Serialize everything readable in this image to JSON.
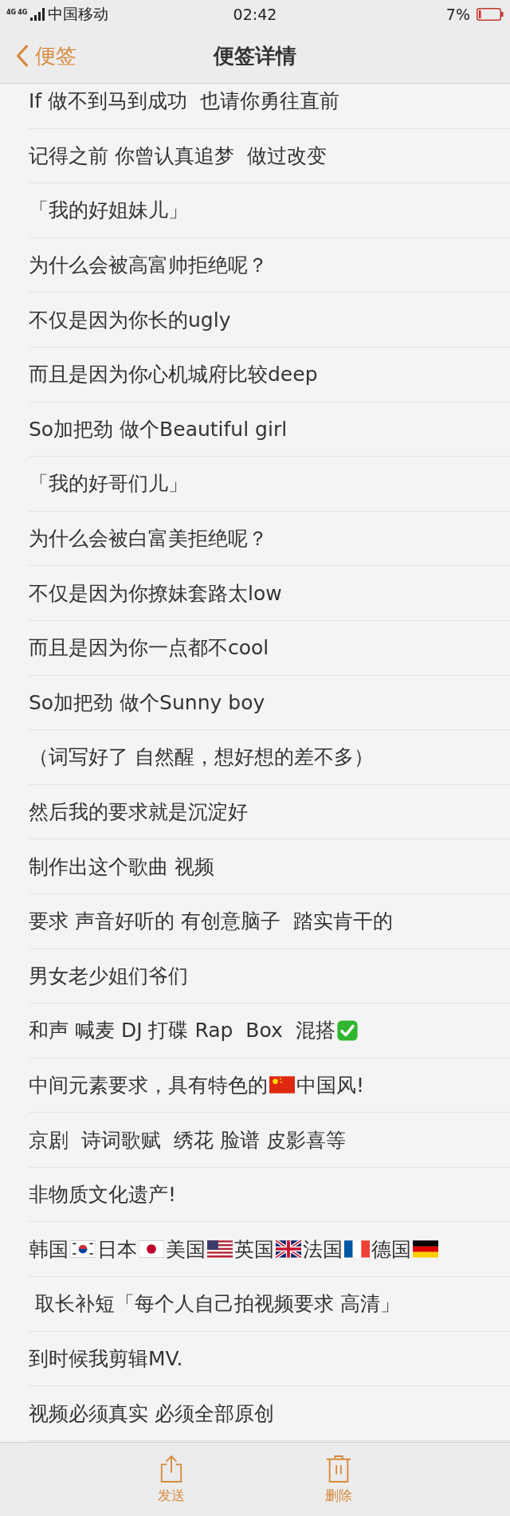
{
  "status_bar": {
    "network": "4G",
    "network_2": "4G",
    "carrier": "中国移动",
    "time": "02:42",
    "battery_percent": "7%"
  },
  "nav_bar": {
    "back_label": "便签",
    "title": "便签详情"
  },
  "lines": [
    {
      "segments": [
        {
          "kind": "text",
          "text": "If 做不到马到成功  也请你勇往直前"
        }
      ]
    },
    {
      "segments": [
        {
          "kind": "text",
          "text": "记得之前 你曾认真追梦  做过改变"
        }
      ]
    },
    {
      "segments": [
        {
          "kind": "text",
          "text": "「我的好姐妹儿」"
        }
      ]
    },
    {
      "segments": [
        {
          "kind": "text",
          "text": "为什么会被高富帅拒绝呢？"
        }
      ]
    },
    {
      "segments": [
        {
          "kind": "text",
          "text": "不仅是因为你长的ugly"
        }
      ]
    },
    {
      "segments": [
        {
          "kind": "text",
          "text": "而且是因为你心机城府比较deep"
        }
      ]
    },
    {
      "segments": [
        {
          "kind": "text",
          "text": "So加把劲 做个Beautiful girl"
        }
      ]
    },
    {
      "segments": [
        {
          "kind": "text",
          "text": "「我的好哥们儿」"
        }
      ]
    },
    {
      "segments": [
        {
          "kind": "text",
          "text": "为什么会被白富美拒绝呢？"
        }
      ]
    },
    {
      "segments": [
        {
          "kind": "text",
          "text": "不仅是因为你撩妹套路太low"
        }
      ]
    },
    {
      "segments": [
        {
          "kind": "text",
          "text": "而且是因为你一点都不cool"
        }
      ]
    },
    {
      "segments": [
        {
          "kind": "text",
          "text": "So加把劲 做个Sunny boy"
        }
      ]
    },
    {
      "segments": [
        {
          "kind": "text",
          "text": "（词写好了 自然醒，想好想的差不多）"
        }
      ]
    },
    {
      "segments": [
        {
          "kind": "text",
          "text": "然后我的要求就是沉淀好"
        }
      ]
    },
    {
      "segments": [
        {
          "kind": "text",
          "text": "制作出这个歌曲 视频"
        }
      ]
    },
    {
      "segments": [
        {
          "kind": "text",
          "text": "要求 声音好听的 有创意脑子  踏实肯干的"
        }
      ]
    },
    {
      "segments": [
        {
          "kind": "text",
          "text": "男女老少姐们爷们"
        }
      ]
    },
    {
      "segments": [
        {
          "kind": "text",
          "text": "和声 喊麦 DJ 打碟 Rap  Box  混搭"
        },
        {
          "kind": "check"
        }
      ]
    },
    {
      "segments": [
        {
          "kind": "text",
          "text": "中间元素要求，具有特色的"
        },
        {
          "kind": "cn"
        },
        {
          "kind": "text",
          "text": "中国风!"
        }
      ]
    },
    {
      "segments": [
        {
          "kind": "text",
          "text": "京剧  诗词歌赋  绣花 脸谱 皮影喜等"
        }
      ]
    },
    {
      "segments": [
        {
          "kind": "text",
          "text": "非物质文化遗产!"
        }
      ]
    },
    {
      "segments": [
        {
          "kind": "text",
          "text": "韩国"
        },
        {
          "kind": "kr"
        },
        {
          "kind": "text",
          "text": "日本"
        },
        {
          "kind": "jp"
        },
        {
          "kind": "text",
          "text": "美国"
        },
        {
          "kind": "us"
        },
        {
          "kind": "text",
          "text": "英国"
        },
        {
          "kind": "gb"
        },
        {
          "kind": "text",
          "text": "法国"
        },
        {
          "kind": "fr"
        },
        {
          "kind": "text",
          "text": "德国"
        },
        {
          "kind": "de"
        }
      ]
    },
    {
      "segments": [
        {
          "kind": "text",
          "text": " 取长补短「每个人自己拍视频要求 高清」"
        }
      ]
    },
    {
      "segments": [
        {
          "kind": "text",
          "text": "到时候我剪辑MV."
        }
      ]
    },
    {
      "segments": [
        {
          "kind": "text",
          "text": "视频必须真实 必须全部原创"
        }
      ]
    }
  ],
  "toolbar": [
    {
      "kind": "share",
      "label": "发送"
    },
    {
      "kind": "delete",
      "label": "删除"
    }
  ]
}
